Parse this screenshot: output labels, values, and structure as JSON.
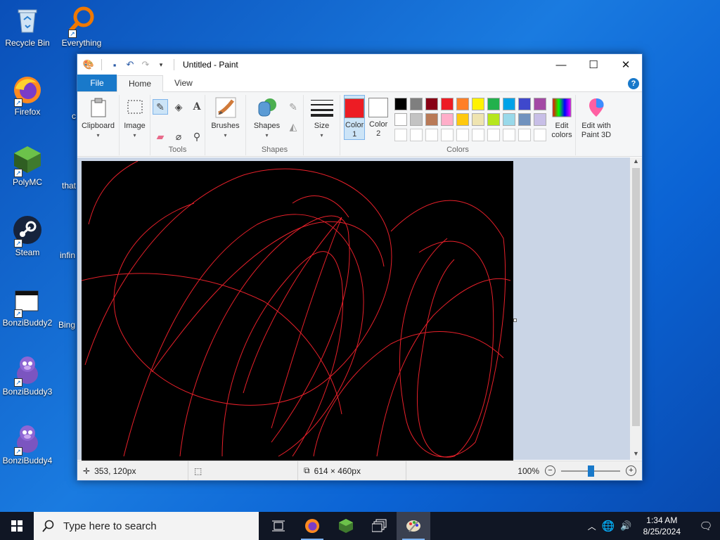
{
  "desktop": {
    "icons": [
      {
        "label": "Recycle Bin",
        "icon": "recycle-bin-icon"
      },
      {
        "label": "Everything",
        "icon": "everything-search-icon"
      },
      {
        "label": "Firefox",
        "icon": "firefox-icon"
      },
      {
        "label": "PolyMC",
        "icon": "polymc-icon"
      },
      {
        "label": "Steam",
        "icon": "steam-icon"
      },
      {
        "label": "BonziBuddy2",
        "icon": "bonzibuddy2-icon"
      },
      {
        "label": "BonziBuddy3",
        "icon": "bonzibuddy3-icon"
      },
      {
        "label": "BonziBuddy4",
        "icon": "bonzibuddy4-icon"
      }
    ],
    "partial_labels": [
      "c",
      "that",
      "infin",
      "Bing"
    ]
  },
  "paint": {
    "title": "Untitled - Paint",
    "tabs": [
      "File",
      "Home",
      "View"
    ],
    "help": "?",
    "ribbon": {
      "clipboard": "Clipboard",
      "image": "Image",
      "tools_group": "Tools",
      "brushes": "Brushes",
      "shapes": "Shapes",
      "shapes_group": "Shapes",
      "size": "Size",
      "color1": "Color 1",
      "color2": "Color 2",
      "colors_group": "Colors",
      "edit_colors": "Edit colors",
      "edit_paint3d": "Edit with Paint 3D"
    },
    "color1_value": "#ed1c24",
    "color2_value": "#ffffff",
    "palette": [
      "#000000",
      "#7f7f7f",
      "#880015",
      "#ed1c24",
      "#ff7f27",
      "#fff200",
      "#22b14c",
      "#00a2e8",
      "#3f48cc",
      "#a349a4",
      "#ffffff",
      "#c3c3c3",
      "#b97a57",
      "#ffaec9",
      "#ffc90e",
      "#efe4b0",
      "#b5e61d",
      "#99d9ea",
      "#7092be",
      "#c8bfe7",
      "#ffffff",
      "#ffffff",
      "#ffffff",
      "#ffffff",
      "#ffffff",
      "#ffffff",
      "#ffffff",
      "#ffffff",
      "#ffffff",
      "#ffffff"
    ],
    "stroke_color": "#e8202a",
    "status": {
      "cursor_pos": "353, 120px",
      "selection": "",
      "image_size": "614 × 460px",
      "zoom": "100%"
    },
    "zoom_level": 0.5
  },
  "taskbar": {
    "search_placeholder": "Type here to search",
    "time": "1:34 AM",
    "date": "8/25/2024"
  }
}
